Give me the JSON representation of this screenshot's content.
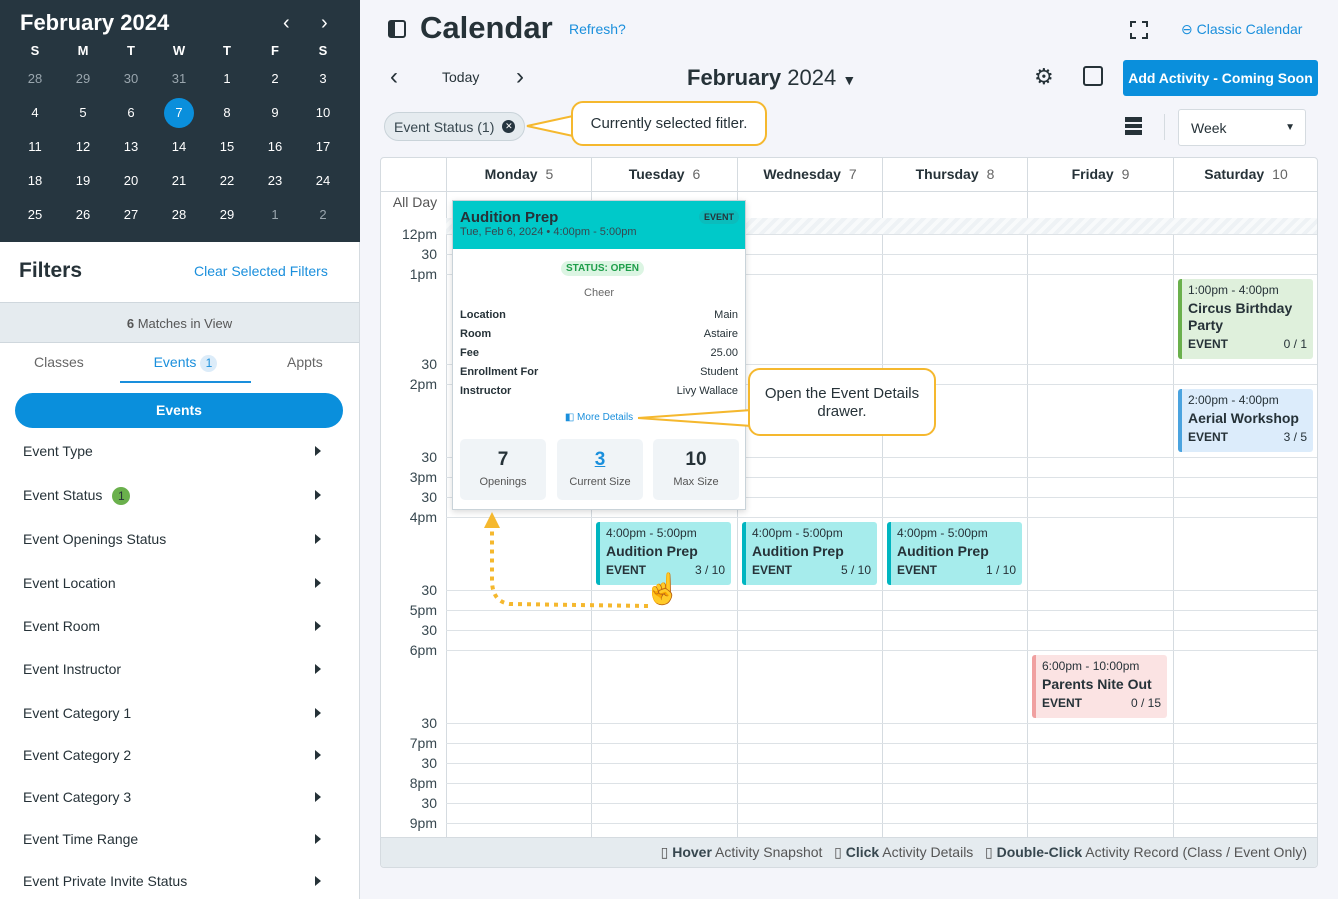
{
  "mini_calendar": {
    "title": "February 2024",
    "weekdays": [
      "S",
      "M",
      "T",
      "W",
      "T",
      "F",
      "S"
    ],
    "weeks": [
      [
        "28",
        "29",
        "30",
        "31",
        "1",
        "2",
        "3"
      ],
      [
        "4",
        "5",
        "6",
        "7",
        "8",
        "9",
        "10"
      ],
      [
        "11",
        "12",
        "13",
        "14",
        "15",
        "16",
        "17"
      ],
      [
        "18",
        "19",
        "20",
        "21",
        "22",
        "23",
        "24"
      ],
      [
        "25",
        "26",
        "27",
        "28",
        "29",
        "1",
        "2"
      ]
    ],
    "selected": "7"
  },
  "filters": {
    "title": "Filters",
    "clear": "Clear Selected Filters",
    "matches_count": "6",
    "matches_label": " Matches in View",
    "tabs": [
      {
        "label": "Classes"
      },
      {
        "label": "Events",
        "count": "1"
      },
      {
        "label": "Appts"
      }
    ],
    "section_button": "Events",
    "items": [
      {
        "label": "Event Type"
      },
      {
        "label": "Event Status",
        "badge": "1"
      },
      {
        "label": "Event Openings Status"
      },
      {
        "label": "Event Location"
      },
      {
        "label": "Event Room"
      },
      {
        "label": "Event Instructor"
      },
      {
        "label": "Event Category 1"
      },
      {
        "label": "Event Category 2"
      },
      {
        "label": "Event Category 3"
      },
      {
        "label": "Event Time Range"
      },
      {
        "label": "Event Private Invite Status"
      }
    ]
  },
  "header": {
    "title": "Calendar",
    "refresh": "Refresh?",
    "classic": "Classic Calendar",
    "today": "Today",
    "month": "February",
    "year": "2024",
    "add": "Add Activity - Coming Soon",
    "chip": "Event Status (1)",
    "view": "Week"
  },
  "callouts": {
    "filter": "Currently selected fitler.",
    "drawer": "Open the Event Details drawer."
  },
  "days": [
    {
      "name": "Monday",
      "num": "5"
    },
    {
      "name": "Tuesday",
      "num": "6"
    },
    {
      "name": "Wednesday",
      "num": "7"
    },
    {
      "name": "Thursday",
      "num": "8"
    },
    {
      "name": "Friday",
      "num": "9"
    },
    {
      "name": "Saturday",
      "num": "10"
    }
  ],
  "all_day": "All Day",
  "time_labels": [
    "12pm",
    "30",
    "1pm",
    "30",
    "2pm",
    "30",
    "3pm",
    "30",
    "4pm",
    "30",
    "5pm",
    "30",
    "6pm",
    "30",
    "7pm",
    "30",
    "8pm",
    "30",
    "9pm"
  ],
  "events": [
    {
      "time": "1:00pm - 4:00pm",
      "title": "Circus Birthday Party",
      "type": "EVENT",
      "count": "0 / 1",
      "color": "#dff0dc",
      "border": "#6ab04c"
    },
    {
      "time": "2:00pm - 4:00pm",
      "title": "Aerial Workshop",
      "type": "EVENT",
      "count": "3 / 5",
      "color": "#dcecfb",
      "border": "#4aa3df"
    },
    {
      "time": "4:00pm - 5:00pm",
      "title": "Audition Prep",
      "type": "EVENT",
      "count": "3 / 10",
      "color": "#a6ecec",
      "border": "#00b5c0"
    },
    {
      "time": "4:00pm - 5:00pm",
      "title": "Audition Prep",
      "type": "EVENT",
      "count": "5 / 10",
      "color": "#a6ecec",
      "border": "#00b5c0"
    },
    {
      "time": "4:00pm - 5:00pm",
      "title": "Audition Prep",
      "type": "EVENT",
      "count": "1 / 10",
      "color": "#a6ecec",
      "border": "#00b5c0"
    },
    {
      "time": "6:00pm - 10:00pm",
      "title": "Parents Nite Out",
      "type": "EVENT",
      "count": "0 / 15",
      "color": "#fbe3e3",
      "border": "#f0a0a0"
    }
  ],
  "popover": {
    "title": "Audition Prep",
    "tag": "EVENT",
    "date": "Tue, Feb 6, 2024 • 4:00pm - 5:00pm",
    "status": "STATUS: OPEN",
    "category": "Cheer",
    "rows": [
      {
        "k": "Location",
        "v": "Main"
      },
      {
        "k": "Room",
        "v": "Astaire"
      },
      {
        "k": "Fee",
        "v": "25.00"
      },
      {
        "k": "Enrollment For",
        "v": "Student"
      },
      {
        "k": "Instructor",
        "v": "Livy Wallace"
      }
    ],
    "more": "More Details",
    "openings": "7",
    "openings_label": "Openings",
    "current": "3",
    "current_label": "Current Size",
    "max": "10",
    "max_label": "Max Size"
  },
  "footer": {
    "hover_b": "Hover",
    "hover": " Activity Snapshot",
    "click_b": "Click",
    "click": " Activity Details",
    "dbl_b": "Double-Click",
    "dbl": " Activity Record (Class / Event Only)"
  }
}
